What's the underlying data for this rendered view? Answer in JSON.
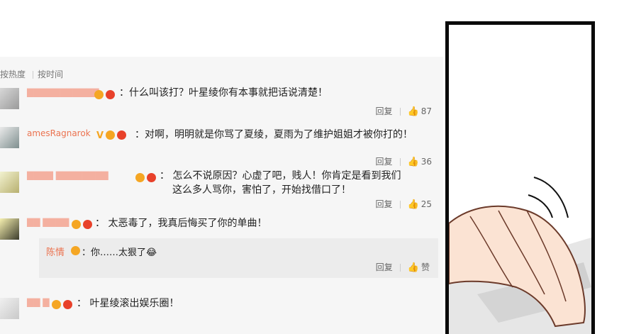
{
  "sort": {
    "by_hot": "按热度",
    "by_time": "按时间"
  },
  "comments": [
    {
      "username": "",
      "text": "：什么叫该打？叶星绫你有本事就把话说清楚！",
      "reply": "回复",
      "likes": "87"
    },
    {
      "username": "amesRagnarok",
      "text": "：对啊，明明就是你骂了夏绫，夏雨为了维护姐姐才被你打的！",
      "reply": "回复",
      "likes": "36"
    },
    {
      "username": "",
      "text_line1": "：  怎么不说原因？心虚了吧，贱人！你肯定是看到我们",
      "text_line2": "这么多人骂你，害怕了，开始找借口了！",
      "reply": "回复",
      "likes": "25"
    },
    {
      "username": "",
      "text": "：  太恶毒了，我真后悔买了你的单曲！"
    },
    {
      "username": "",
      "text": "：  叶星绫滚出娱乐圈！"
    }
  ],
  "nested_reply": {
    "username": "陈情",
    "text": "：你……太狠了😂",
    "reply": "回复",
    "like_label": "赞"
  },
  "colors": {
    "username": "#eb7350",
    "panel_bg": "#f6f6f6",
    "reply_bg": "#ececec"
  },
  "icons": {
    "like": "thumbs-up-icon",
    "vip": "vip-badge-icon"
  }
}
